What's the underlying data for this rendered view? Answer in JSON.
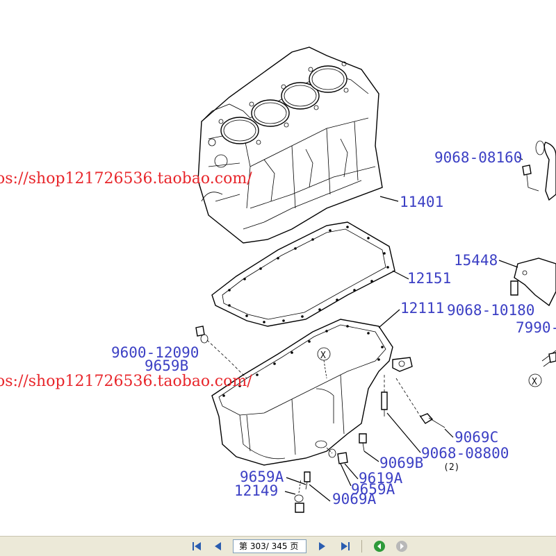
{
  "diagram": {
    "part_numbers": {
      "p9068_08160": "9068-08160",
      "p11401": "11401",
      "p15448": "15448",
      "p12151": "12151",
      "p12111": "12111",
      "p9068_10180": "9068-10180",
      "p7990": "7990-",
      "p9600_12090": "9600-12090",
      "p9659B": "9659B",
      "p9069C": "9069C",
      "p9069B": "9069B",
      "p9068_08800": "9068-08800",
      "p2": "(2)",
      "p9659A_left": "9659A",
      "p9619A": "9619A",
      "p9659A_right": "9659A",
      "p12149": "12149",
      "p9069A": "9069A",
      "x_marker": "X"
    },
    "watermarks": [
      "os://shop121726536.taobao.com/",
      "os://shop121726536.taobao.com/"
    ]
  },
  "toolbar": {
    "page_prefix": "第",
    "page_current": "303",
    "page_separator": "/",
    "page_total": "345",
    "page_suffix": "页",
    "icons": [
      "first-page-icon",
      "prev-page-icon",
      "next-page-icon",
      "last-page-icon",
      "back-icon",
      "forward-icon"
    ],
    "colors": {
      "toolbar_bg": "#ece9d8",
      "part_number_blue": "#3b3fc4",
      "watermark_red": "#e8262b",
      "nav_blue": "#2a5db0",
      "back_green": "#2e9a3a"
    }
  }
}
